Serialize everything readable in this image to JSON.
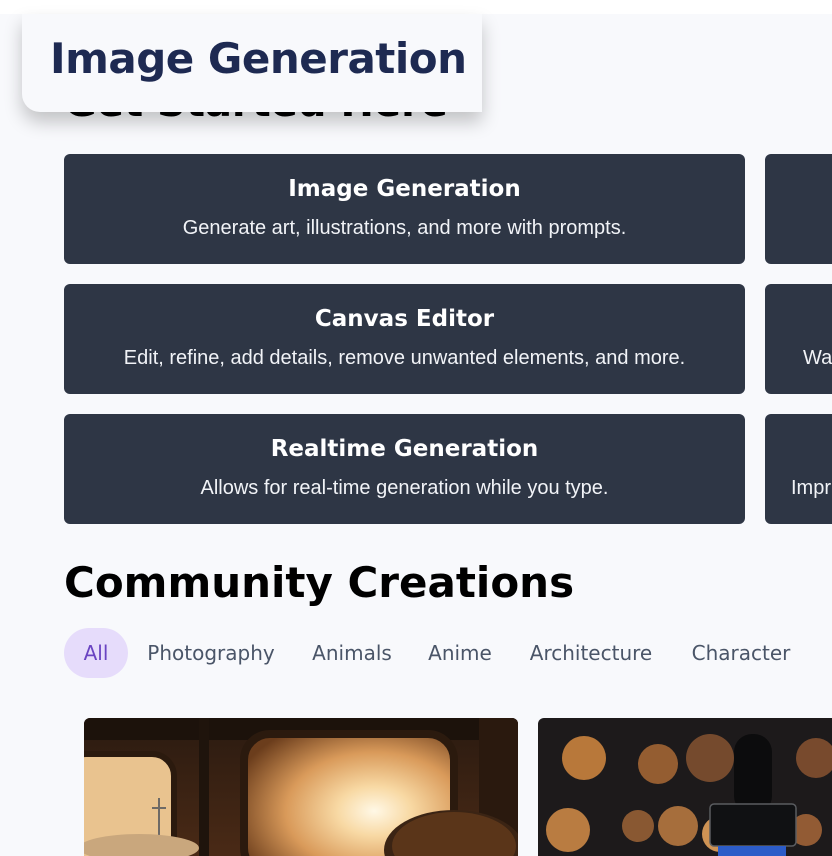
{
  "header": {
    "title": "Image Generation"
  },
  "get_started": {
    "heading": "Get Started Here"
  },
  "tools_left": [
    {
      "title": "Image Generation",
      "description": "Generate art, illustrations, and more with prompts."
    },
    {
      "title": "Canvas Editor",
      "description": "Edit, refine, add details, remove unwanted elements, and more."
    },
    {
      "title": "Realtime Generation",
      "description": "Allows for real-time generation while you type."
    }
  ],
  "tools_right": [
    {
      "description": ""
    },
    {
      "description": "Wa"
    },
    {
      "description": "Impr"
    }
  ],
  "community": {
    "title": "Community Creations",
    "filters": [
      "All",
      "Photography",
      "Animals",
      "Anime",
      "Architecture",
      "Character"
    ],
    "active_filter": "All"
  },
  "colors": {
    "card_bg": "#2e3645",
    "title_navy": "#1e2a52",
    "active_pill_bg": "#e6dcfb",
    "active_pill_text": "#6a44c2"
  },
  "icons": []
}
